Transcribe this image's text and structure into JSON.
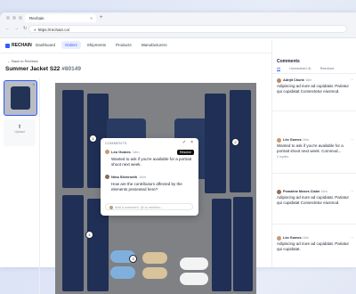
{
  "browser": {
    "tab_title": "Rechain",
    "tab_close": "×",
    "new_tab": "+",
    "back": "←",
    "forward": "→",
    "reload": "↻",
    "url": "https://rechain.co/"
  },
  "nav": {
    "brand": "RECHAIN",
    "links": [
      "Dashboard",
      "Orders",
      "Shipments",
      "Products",
      "Manufacturers"
    ],
    "active": "Orders"
  },
  "page": {
    "back_link": "← Back to Reviews",
    "title": "Summer Jacket S22",
    "order_id": "#80149"
  },
  "thumbs": {
    "close": "×",
    "upload_label": "Upload"
  },
  "pins": [
    "1",
    "2",
    "3",
    "4"
  ],
  "popup": {
    "header": "COMMENTS",
    "resolve_tooltip": "Resolve",
    "close": "×",
    "comments": [
      {
        "name": "Léo Gomes",
        "time": "16m",
        "text": "Wanted to ask if you're available for a portrait shoot next week."
      },
      {
        "name": "Nina Silverneth",
        "time": "16m",
        "text": "How are the contributors affected by the elements presented here?"
      }
    ],
    "input_placeholder": "Add a comment, @ to mention..."
  },
  "comments_panel": {
    "title": "Comments",
    "tabs": [
      {
        "label": "All",
        "count": ""
      },
      {
        "label": "Unresolved",
        "count": "4"
      },
      {
        "label": "Resolved",
        "count": ""
      }
    ],
    "entries": [
      {
        "name": "Adrijit Chorie",
        "time": "16m",
        "text": "Adipiscing ad irure ad cupidatat. Pariatur qui cupidatat Consectetur eiusmod.",
        "replies": ""
      },
      {
        "name": "Léo Gomes",
        "time": "16m",
        "text": "Wanted to ask if you're available for a portrait shoot next week. Commod...",
        "replies": "2 replies"
      },
      {
        "name": "Pomaline Moses Claire",
        "time": "16m",
        "text": "Adipiscing ad irure ad cupidatat. Pariatur qui cupidatat Consectetur eiusmod.",
        "replies": ""
      },
      {
        "name": "Léo Gomes",
        "time": "16m",
        "text": "Adipiscing ad irure ad cupidatat. Pariatur qui cupidatat.",
        "replies": ""
      }
    ]
  },
  "colors": {
    "accent": "#2d5bff",
    "navy": "#1f2f55",
    "image_bg": "#7f8185"
  }
}
